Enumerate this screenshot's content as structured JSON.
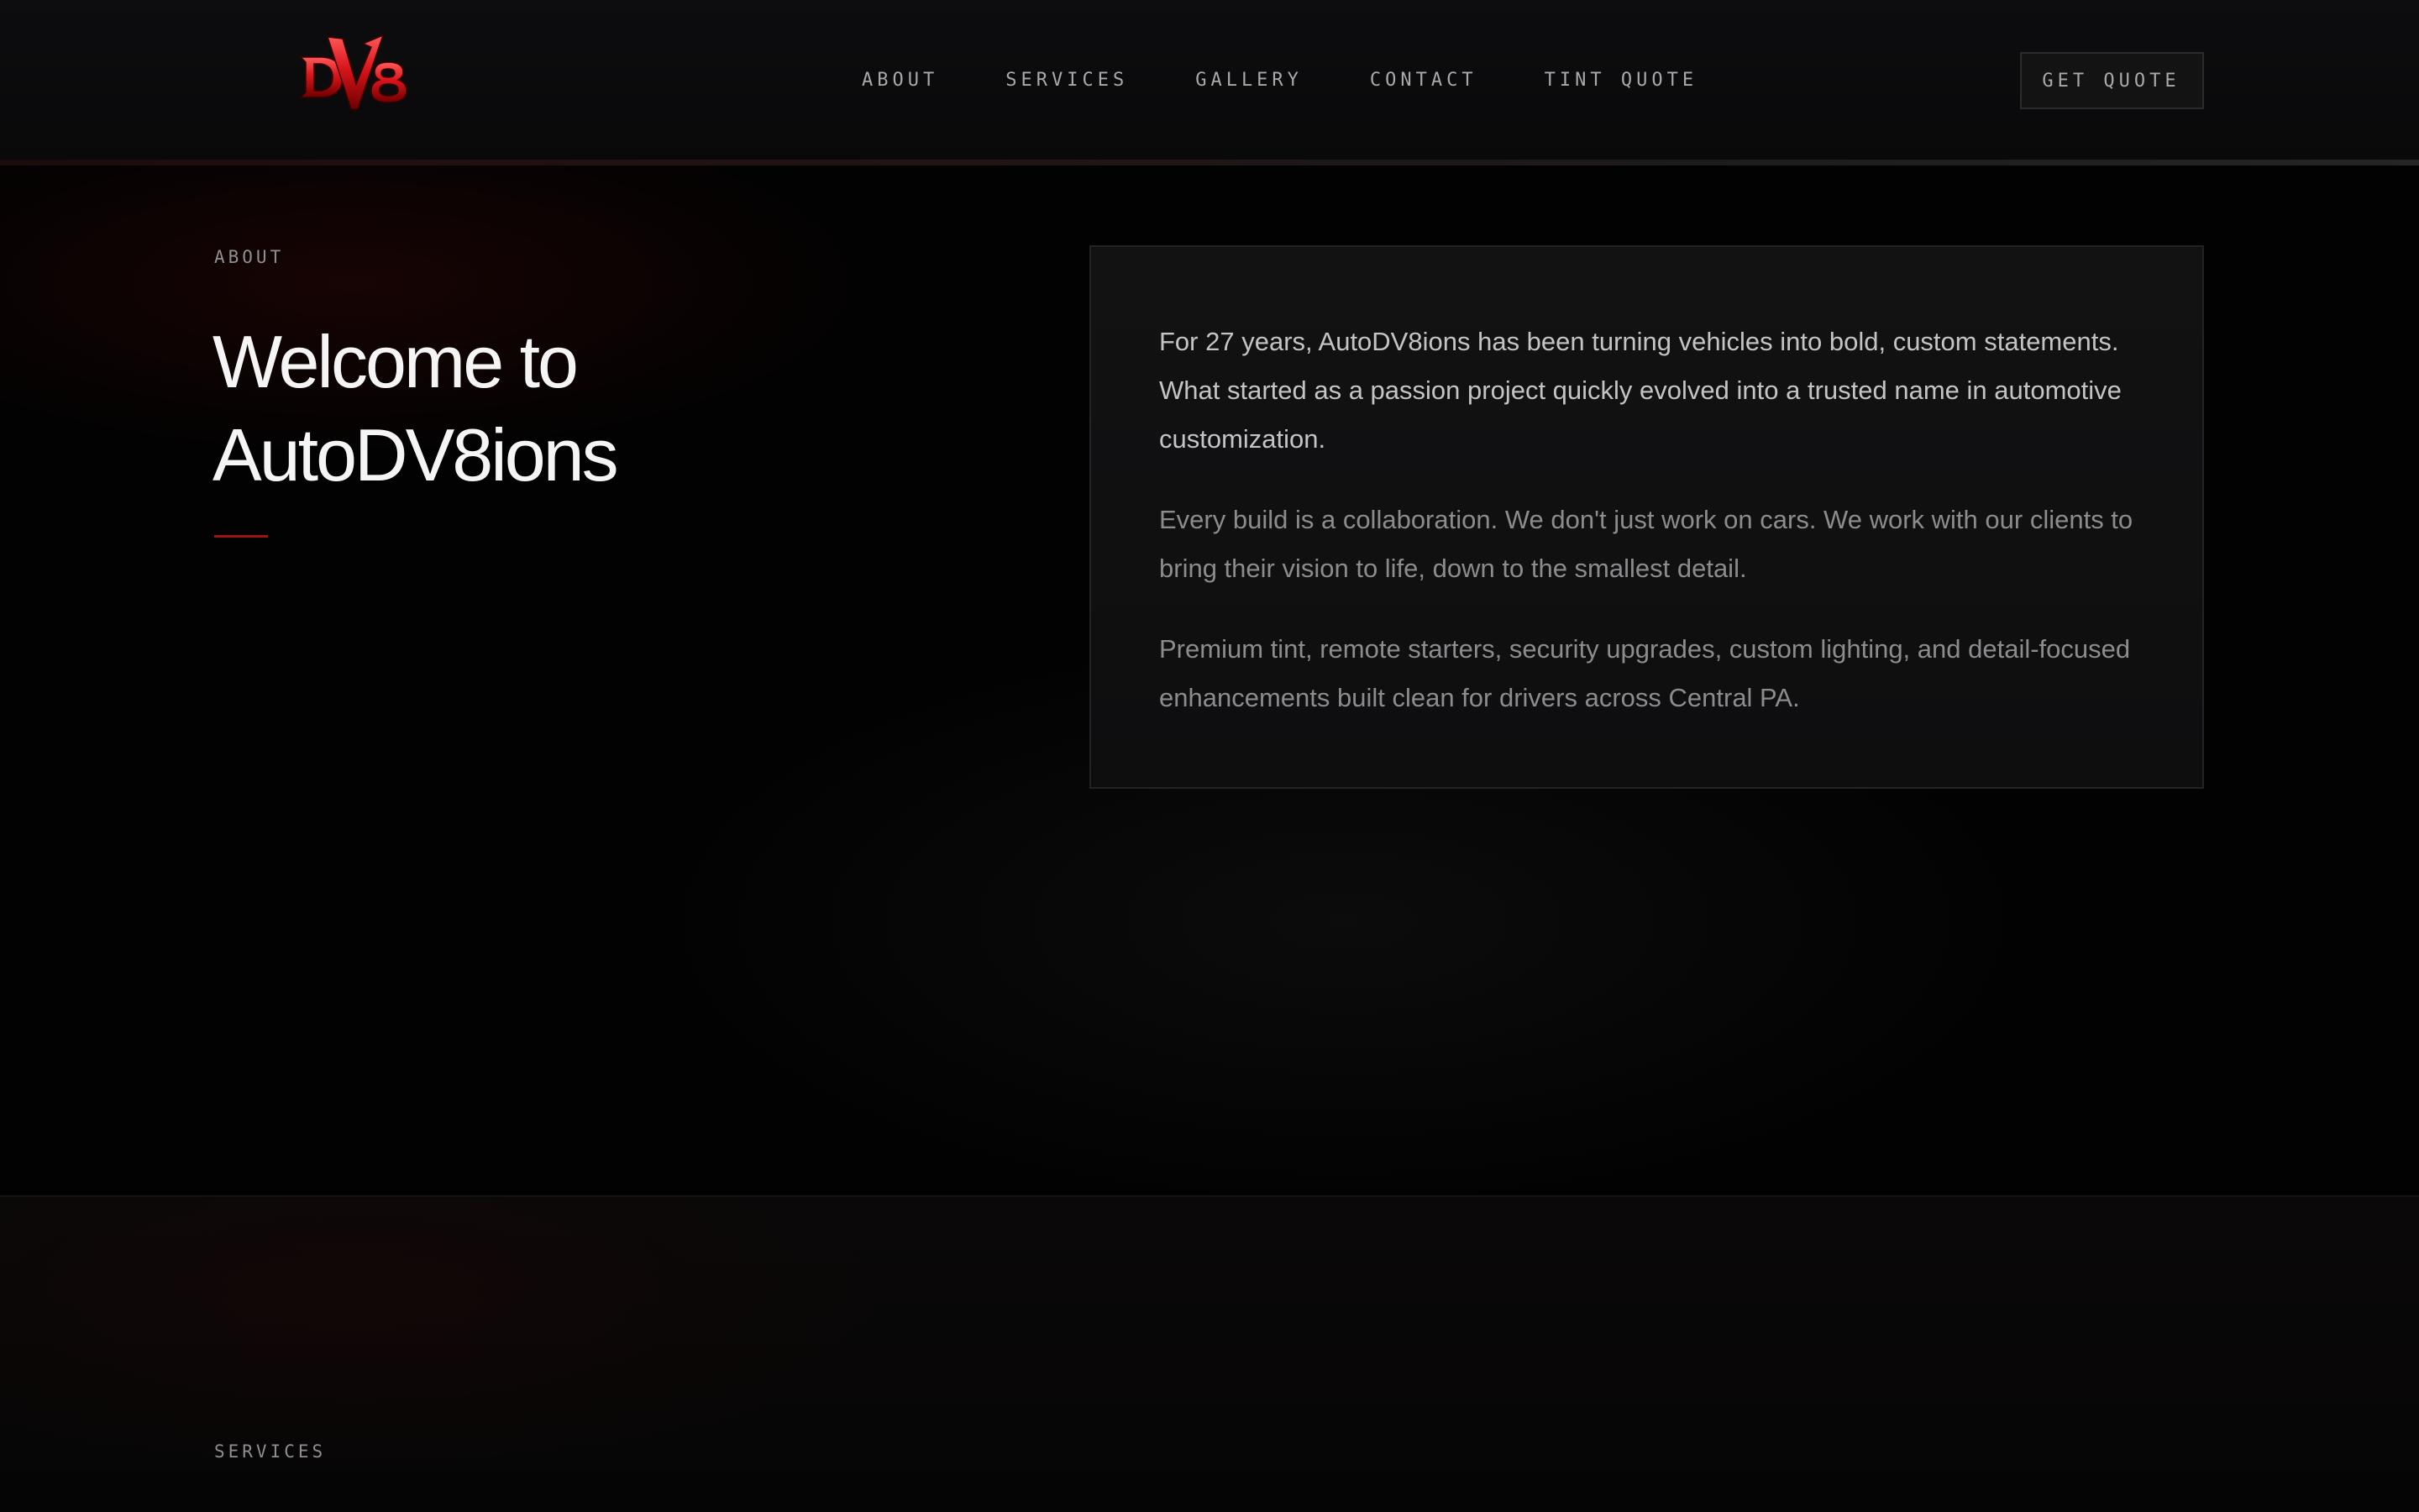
{
  "brand": {
    "logo_text": "DV8",
    "logo_colors": {
      "primary": "#d9141b",
      "dark": "#6e0000",
      "highlight": "#ff5a5a"
    }
  },
  "nav": {
    "links": [
      {
        "label": "ABOUT"
      },
      {
        "label": "SERVICES"
      },
      {
        "label": "GALLERY"
      },
      {
        "label": "CONTACT"
      },
      {
        "label": "TINT QUOTE"
      }
    ],
    "cta_label": "GET QUOTE"
  },
  "about": {
    "kicker": "ABOUT",
    "title_line1": "Welcome to",
    "title_line2": "AutoDV8ions",
    "accent_color": "#9d1212",
    "paragraphs": [
      "For 27 years, AutoDV8ions has been turning vehicles into bold, custom statements. What started as a passion project quickly evolved into a trusted name in automotive customization.",
      "Every build is a collaboration. We don't just work on cars. We work with our clients to bring their vision to life, down to the smallest detail.",
      "Premium tint, remote starters, security upgrades, custom lighting, and detail-focused enhancements built clean for drivers across Central PA."
    ]
  },
  "services": {
    "kicker": "SERVICES"
  },
  "theme": {
    "background": "#030303",
    "muted_text": "#a9a9ab",
    "card_border": "#232325"
  }
}
